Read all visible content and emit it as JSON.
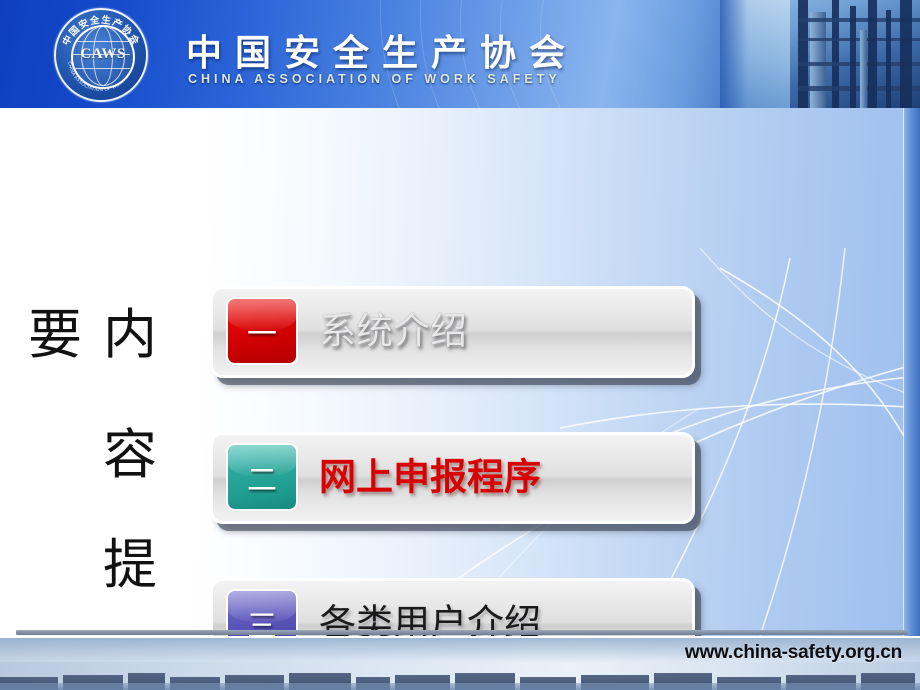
{
  "header": {
    "org_name_cn": "中国安全生产协会",
    "org_name_en": "CHINA ASSOCIATION OF WORK SAFETY",
    "logo": {
      "acronym": "CAWS",
      "arc_top_cn": "中国安全生产协会",
      "arc_bottom_en": "CHINA ASSOCIATION OF WORK SAFETY"
    }
  },
  "slide": {
    "heading_chars": {
      "lead": "要",
      "col": [
        "内",
        "容",
        "提"
      ]
    },
    "heading_full": "内容提要",
    "items": [
      {
        "number": "一",
        "label": "系统介绍",
        "badge_color": "#dc0505",
        "label_style": "light"
      },
      {
        "number": "二",
        "label": "网上申报程序",
        "badge_color": "#2aa79c",
        "label_style": "red"
      },
      {
        "number": "三",
        "label": "各类用户介绍",
        "badge_color": "#5e59bd",
        "label_style": "dark"
      }
    ]
  },
  "footer": {
    "url": "www.china-safety.org.cn"
  },
  "theme": {
    "banner_blue": "#1247c8",
    "body_gradient_start": "#ffffff",
    "body_gradient_end": "#9dbfee",
    "accent_red": "#d80000"
  }
}
